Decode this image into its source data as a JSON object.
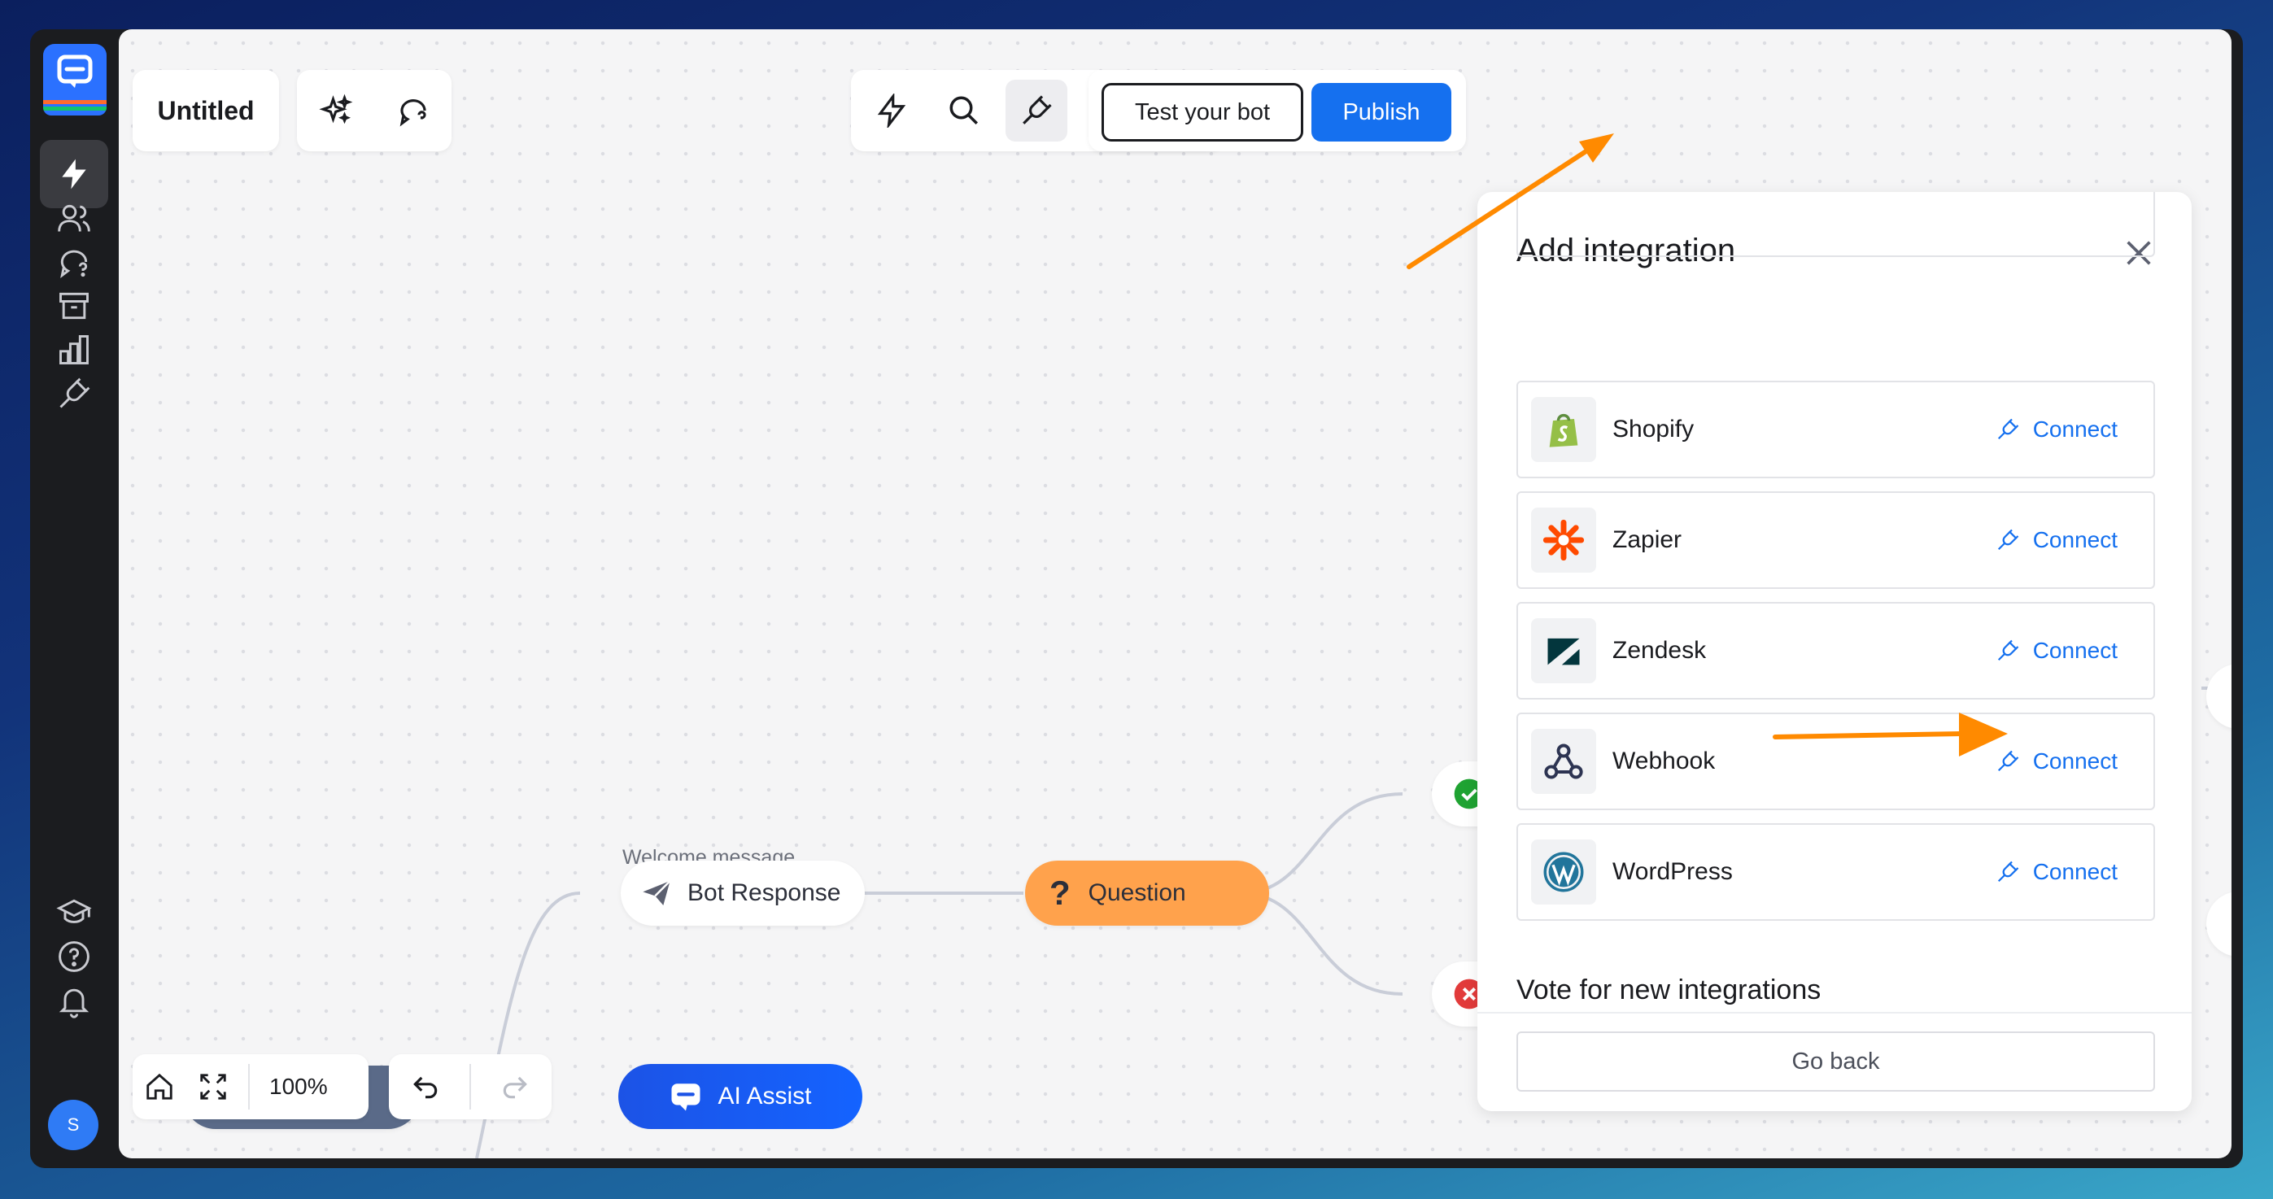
{
  "app": {
    "title": "Untitled",
    "test_bot_label": "Test your bot",
    "publish_label": "Publish"
  },
  "sidebar": {
    "items": [
      {
        "name": "automation",
        "icon": "lightning-icon",
        "active": true
      },
      {
        "name": "audience",
        "icon": "users-icon"
      },
      {
        "name": "chats",
        "icon": "chat-question-icon"
      },
      {
        "name": "archive",
        "icon": "archive-icon"
      },
      {
        "name": "reports",
        "icon": "bar-chart-icon"
      },
      {
        "name": "integrations",
        "icon": "plug-icon"
      },
      {
        "name": "academy",
        "icon": "graduation-cap-icon"
      },
      {
        "name": "help",
        "icon": "help-icon"
      },
      {
        "name": "notifications",
        "icon": "bell-icon"
      }
    ],
    "avatar_initial": "S"
  },
  "flow": {
    "welcome_label": "Welcome message",
    "bot_response_label": "Bot Response",
    "question_label": "Question"
  },
  "panel": {
    "title": "Add integration",
    "integrations": [
      {
        "name": "Shopify",
        "icon": "shopify-icon",
        "action": "Connect"
      },
      {
        "name": "Zapier",
        "icon": "zapier-icon",
        "action": "Connect"
      },
      {
        "name": "Zendesk",
        "icon": "zendesk-icon",
        "action": "Connect"
      },
      {
        "name": "Webhook",
        "icon": "webhook-icon",
        "action": "Connect"
      },
      {
        "name": "WordPress",
        "icon": "wordpress-icon",
        "action": "Connect"
      }
    ],
    "vote_title": "Vote for new integrations",
    "go_back_label": "Go back"
  },
  "bottom_toolbar": {
    "zoom_level": "100%",
    "ai_assist_label": "AI Assist"
  },
  "colors": {
    "accent": "#1570ef",
    "question_node": "#ffa24c",
    "arrow_annotation": "#ff8a00",
    "sidebar_bg": "#1b1c1f"
  }
}
